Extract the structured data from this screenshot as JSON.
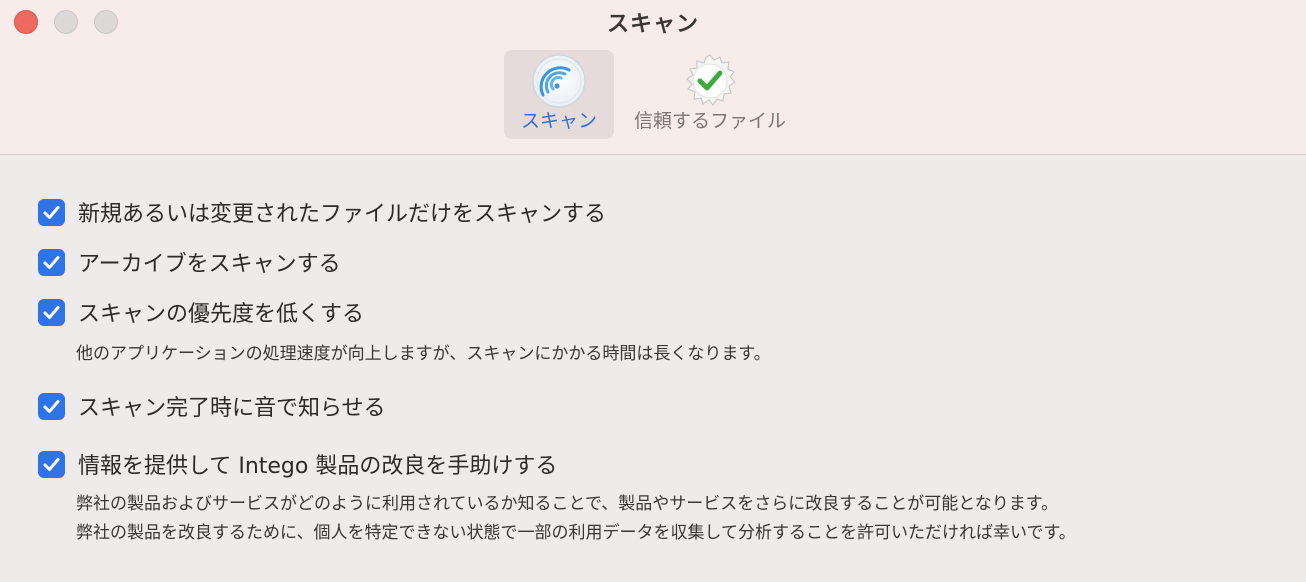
{
  "window": {
    "title": "スキャン"
  },
  "tabs": [
    {
      "label": "スキャン",
      "icon": "scan-radar-icon",
      "selected": true
    },
    {
      "label": "信頼するファイル",
      "icon": "verified-badge-icon",
      "selected": false
    }
  ],
  "colors": {
    "accent": "#2f74e6",
    "selected_tab_text": "#2f6fd7",
    "close_button": "#ec6a5f",
    "trusted_check": "#3daa3c"
  },
  "options": [
    {
      "label": "新規あるいは変更されたファイルだけをスキャンする",
      "checked": true
    },
    {
      "label": "アーカイブをスキャンする",
      "checked": true
    },
    {
      "label": "スキャンの優先度を低くする",
      "checked": true,
      "description": "他のアプリケーションの処理速度が向上しますが、スキャンにかかる時間は長くなります。"
    },
    {
      "label": "スキャン完了時に音で知らせる",
      "checked": true
    },
    {
      "label": "情報を提供して Intego 製品の改良を手助けする",
      "checked": true,
      "description_lines": [
        "弊社の製品およびサービスがどのように利用されているか知ることで、製品やサービスをさらに改良することが可能となります。",
        "弊社の製品を改良するために、個人を特定できない状態で一部の利用データを収集して分析することを許可いただければ幸いです。"
      ]
    }
  ]
}
